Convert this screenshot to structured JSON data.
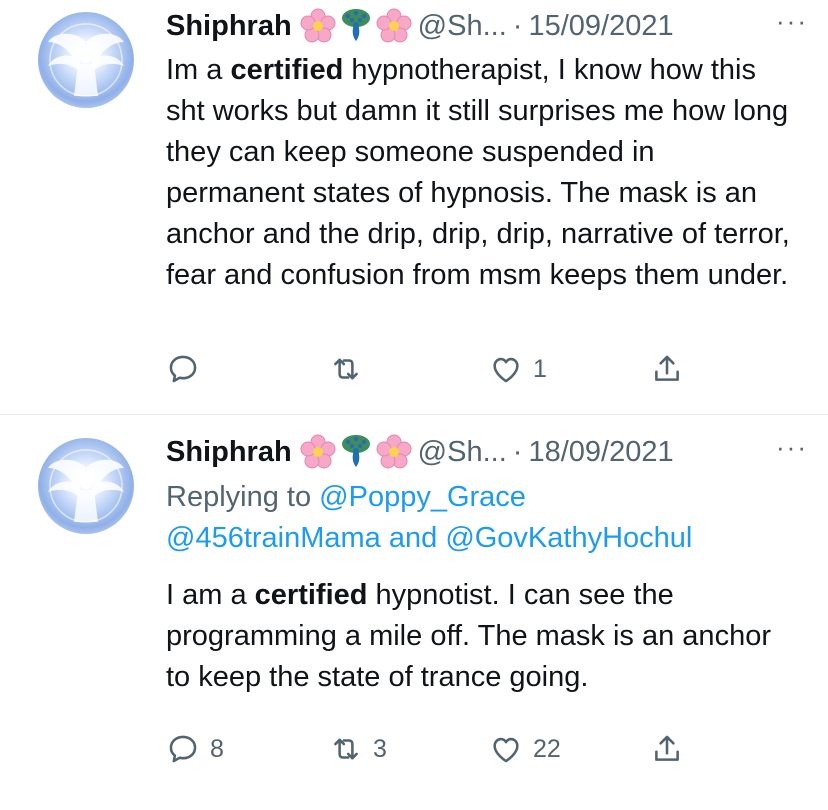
{
  "tweets": [
    {
      "name": "Shiphrah",
      "handle": "@Sh...",
      "separator": "·",
      "date": "15/09/2021",
      "more": "···",
      "body_parts": [
        "Im a ",
        "certified",
        " hypnotherapist, I know how this sht works but damn it still surprises me how long they can keep someone suspended in permanent states of hypnosis. The mask is an anchor and the drip, drip, drip, narrative of terror, fear and confusion from msm keeps them under."
      ],
      "reply_count": "",
      "retweet_count": "",
      "like_count": "1"
    },
    {
      "name": "Shiphrah",
      "handle": "@Sh...",
      "separator": "·",
      "date": "18/09/2021",
      "more": "···",
      "replying_to_label": "Replying to ",
      "replying_mention_1": "@Poppy_Grace",
      "replying_mention_2": "@456trainMama",
      "replying_and": " and ",
      "replying_mention_3": "@GovKathyHochul",
      "body_parts": [
        "I am a ",
        "certified",
        " hypnotist. I can see the programming a mile off. The mask is an anchor to keep the state of trance going."
      ],
      "reply_count": "8",
      "retweet_count": "3",
      "like_count": "22"
    }
  ],
  "icons": [
    "avatar-angel-image",
    "cherry-blossom-icon",
    "peacock-icon",
    "reply-icon",
    "retweet-icon",
    "like-icon",
    "share-icon"
  ],
  "colors": {
    "text": "#0f1419",
    "secondary": "#536471",
    "link": "#1d9bf0",
    "divider": "#e6ecf0",
    "blossom": "#f7a8c8"
  }
}
